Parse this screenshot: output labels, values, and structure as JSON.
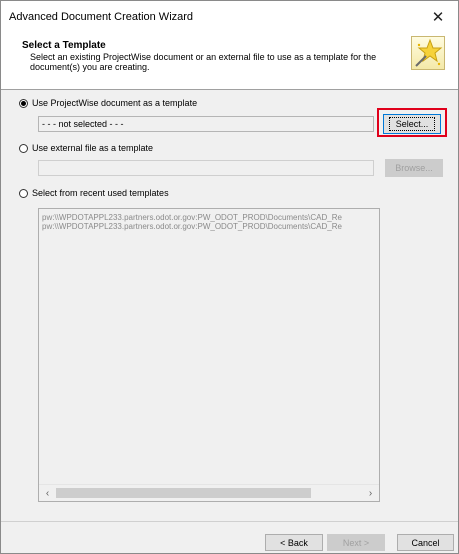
{
  "window": {
    "title": "Advanced Document Creation Wizard",
    "close_glyph": "✕"
  },
  "header": {
    "title": "Select a Template",
    "description": "Select an existing ProjectWise document or an external file to use as a template for the document(s) you are creating.",
    "icon": "wizard-star-icon"
  },
  "options": {
    "projectwise": {
      "label": "Use ProjectWise document as a template",
      "checked": true,
      "value": "- - - not selected - - -",
      "select_button": "Select..."
    },
    "external": {
      "label": "Use external file as a template",
      "checked": false,
      "value": "",
      "browse_button": "Browse..."
    },
    "recent": {
      "label": "Select from recent used templates",
      "checked": false,
      "items": [
        "pw:\\\\WPDOTAPPL233.partners.odot.or.gov:PW_ODOT_PROD\\Documents\\CAD_Re",
        "pw:\\\\WPDOTAPPL233.partners.odot.or.gov:PW_ODOT_PROD\\Documents\\CAD_Re"
      ]
    }
  },
  "footer": {
    "back": "< Back",
    "next": "Next >",
    "cancel": "Cancel"
  },
  "colors": {
    "highlight": "#e0001b",
    "background": "#f0f0f0"
  }
}
